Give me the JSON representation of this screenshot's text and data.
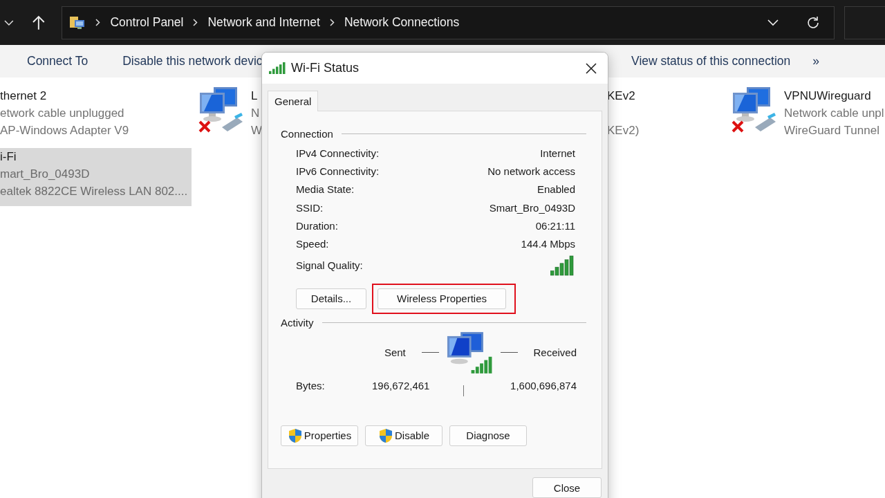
{
  "address_bar": {
    "breadcrumb": [
      "Control Panel",
      "Network and Internet",
      "Network Connections"
    ]
  },
  "command_bar": {
    "commands": [
      "Connect To",
      "Disable this network devic",
      "View status of this connection"
    ],
    "more": "»"
  },
  "connections": [
    {
      "kind": "text",
      "name": "thernet 2",
      "status": "etwork cable unplugged",
      "device": "AP-Windows Adapter V9",
      "selected": false
    },
    {
      "kind": "icon",
      "name": "L",
      "status": "N",
      "device": "W",
      "selected": false
    },
    {
      "kind": "text",
      "name": "KEv2",
      "device": "KEv2)",
      "selected": false
    },
    {
      "kind": "icon",
      "name": "VPNUWireguard",
      "status": "Network cable unpl",
      "device": "WireGuard Tunnel",
      "selected": false
    },
    {
      "kind": "text",
      "name": "i-Fi",
      "status": "mart_Bro_0493D",
      "device": "ealtek 8822CE Wireless LAN 802....",
      "selected": true
    }
  ],
  "dialog": {
    "title": "Wi-Fi Status",
    "close": "Close",
    "tabs": [
      {
        "label": "General",
        "selected": true
      }
    ],
    "connection": {
      "heading": "Connection",
      "rows": [
        {
          "kind": "text",
          "label": "IPv4 Connectivity:",
          "value": "Internet"
        },
        {
          "kind": "text",
          "label": "IPv6 Connectivity:",
          "value": "No network access"
        },
        {
          "kind": "text",
          "label": "Media State:",
          "value": "Enabled"
        },
        {
          "kind": "text",
          "label": "SSID:",
          "value": "Smart_Bro_0493D"
        },
        {
          "kind": "text",
          "label": "Duration:",
          "value": "06:21:11"
        },
        {
          "kind": "text",
          "label": "Speed:",
          "value": "144.4 Mbps"
        },
        {
          "kind": "signal",
          "label": "Signal Quality:"
        }
      ],
      "buttons": [
        {
          "label": "Details...",
          "highlighted": false
        },
        {
          "label": "Wireless Properties",
          "highlighted": true
        }
      ]
    },
    "activity": {
      "heading": "Activity",
      "sent": "Sent",
      "received": "Received",
      "bytes_label": "Bytes:",
      "bytes_sent": "196,672,461",
      "bytes_received": "1,600,696,874"
    },
    "buttons": [
      {
        "label": "Properties",
        "shield": true
      },
      {
        "label": "Disable",
        "shield": true
      },
      {
        "label": "Diagnose",
        "shield": false
      }
    ]
  }
}
